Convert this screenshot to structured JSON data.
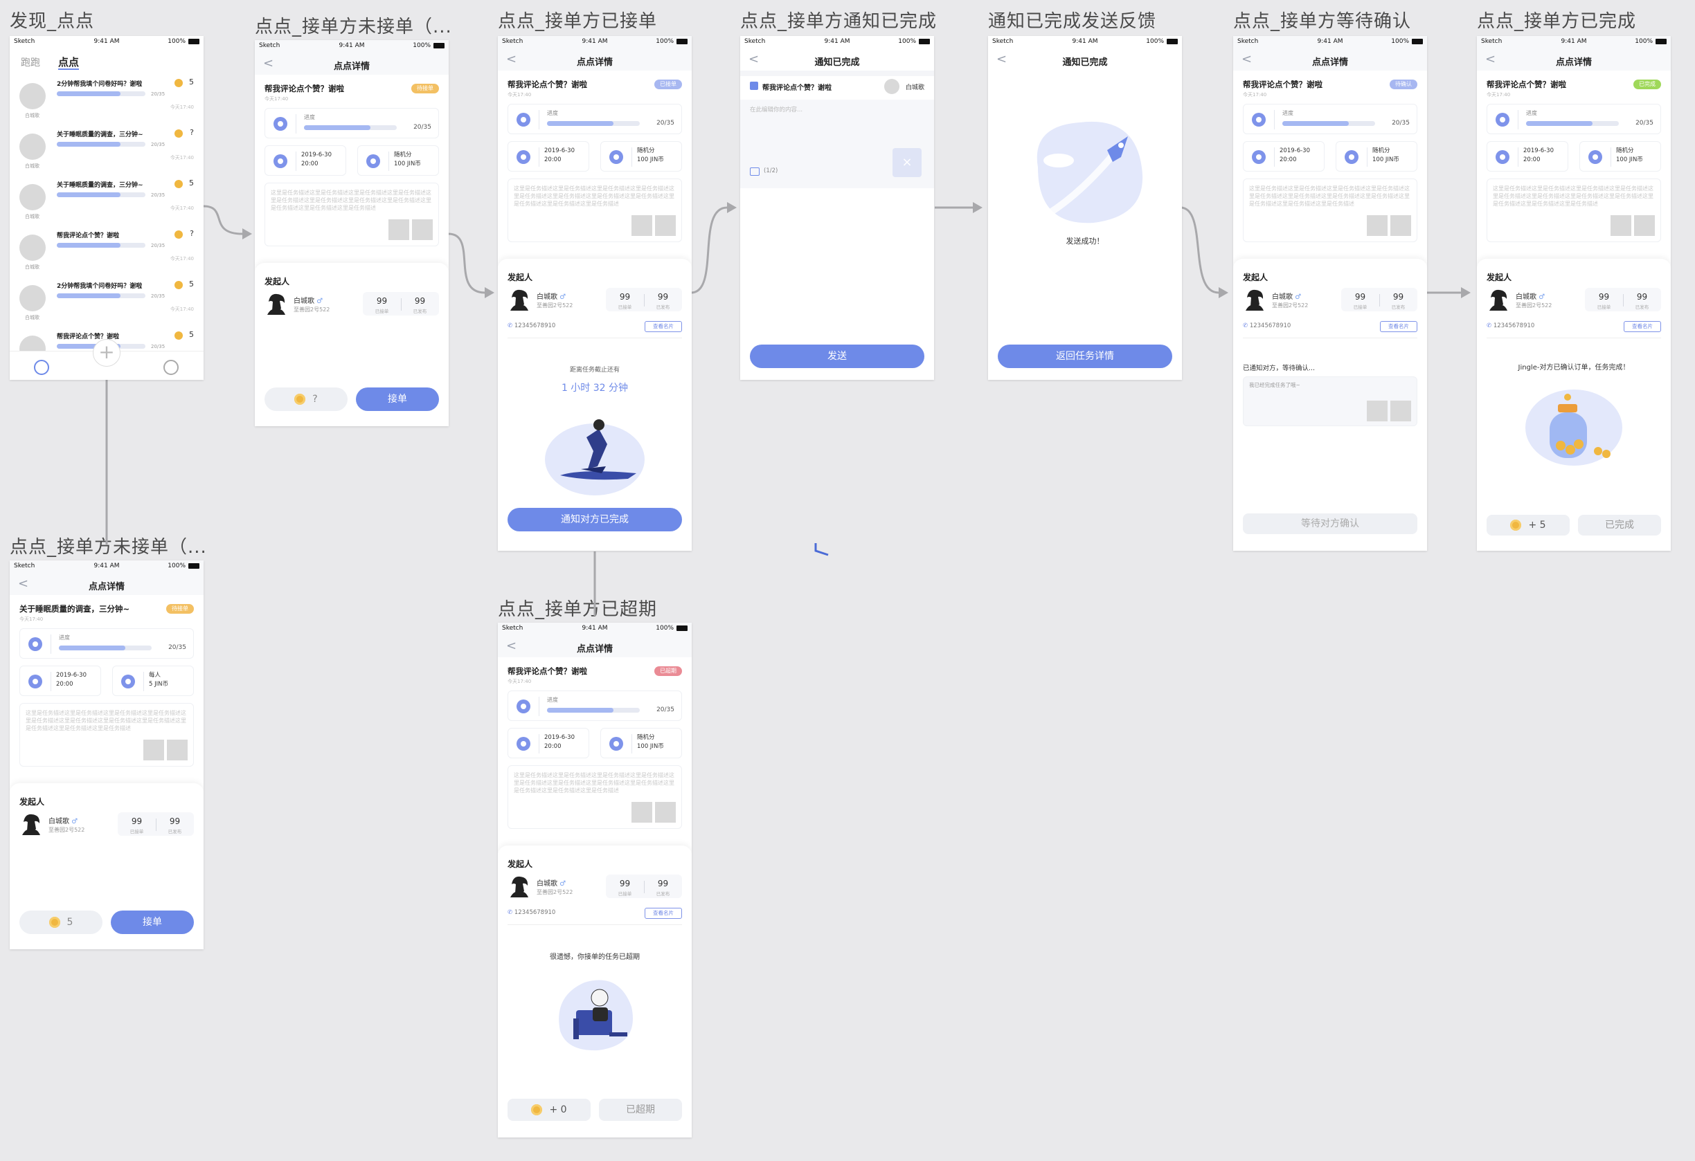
{
  "labels": {
    "discover": "发现_点点",
    "not_taken_a": "点点_接单方未接单（...",
    "not_taken_b": "点点_接单方未接单（...",
    "taken": "点点_接单方已接单",
    "notify": "点点_接单方通知已完成",
    "feedback": "通知已完成发送反馈",
    "waiting": "点点_接单方等待确认",
    "done": "点点_接单方已完成",
    "overdue": "点点_接单方已超期"
  },
  "status_bar": {
    "carrier": "Sketch",
    "time": "9:41 AM",
    "battery": "100%"
  },
  "nav": {
    "detail_title": "点点详情",
    "notify_title": "通知已完成",
    "back_glyph": "<"
  },
  "discover": {
    "tab_run": "跑跑",
    "tab_dot": "点点",
    "user_name": "白城歌",
    "items": [
      {
        "title": "2分钟帮我填个问卷好吗？谢啦",
        "count": "20/35",
        "time": "今天17:40",
        "reward": "5"
      },
      {
        "title": "关于睡眠质量的调查，三分钟~",
        "count": "20/35",
        "time": "今天17:40",
        "reward": "?"
      },
      {
        "title": "关于睡眠质量的调查，三分钟~",
        "count": "20/35",
        "time": "今天17:40",
        "reward": "5"
      },
      {
        "title": "帮我评论点个赞？谢啦",
        "count": "20/35",
        "time": "今天17:40",
        "reward": "?"
      },
      {
        "title": "2分钟帮我填个问卷好吗？谢啦",
        "count": "20/35",
        "time": "今天17:40",
        "reward": "5"
      },
      {
        "title": "帮我评论点个赞？谢啦",
        "count": "20/35",
        "time": "今天17:40",
        "reward": "5"
      }
    ]
  },
  "task": {
    "title": "帮我评论点个赞？谢啦",
    "title_sleep": "关于睡眠质量的调查，三分钟~",
    "posted": "今天17:40",
    "progress_label": "进度",
    "progress_value": "20/35",
    "progress_fraction": 0.72,
    "deadline_date": "2019-6-30",
    "deadline_time": "20:00",
    "reward_random": "随机分",
    "reward_random_amount": "100 JIN币",
    "reward_each": "每人",
    "reward_each_amount": "5 JIN币",
    "description": "这里是任务描述这里是任务描述这里是任务描述这里是任务描述这里是任务描述这里是任务描述这里是任务描述这里是任务描述这里是任务描述这里是任务描述这里是任务描述"
  },
  "badges": {
    "pending": "待接单",
    "taken": "已接单",
    "waiting": "待确认",
    "done": "已完成",
    "overdue": "已超期"
  },
  "initiator": {
    "section": "发起人",
    "name": "白城歌",
    "gender": "♂",
    "address": "至善园2号522",
    "taken_count": "99",
    "taken_label": "已接单",
    "posted_count": "99",
    "posted_label": "已发布",
    "phone": "12345678910",
    "card_button": "查看名片"
  },
  "buttons": {
    "accept": "接单",
    "coin_unknown": "?",
    "coin_five": "5",
    "notify_done": "通知对方已完成",
    "send": "发送",
    "back_to_task": "返回任务详情",
    "waiting_confirm": "等待对方确认",
    "plus_five": "+ 5",
    "done": "已完成",
    "plus_zero": "+ 0",
    "overdue": "已超期"
  },
  "taken_screen": {
    "countdown_label": "距离任务截止还有",
    "countdown_value": "1 小时 32 分钟"
  },
  "notify_screen": {
    "partner": "白城歌",
    "placeholder": "在此编辑你的内容...",
    "image_count": "(1/2)"
  },
  "feedback_screen": {
    "success": "发送成功！"
  },
  "waiting_screen": {
    "notified": "已通知对方，等待确认...",
    "message": "我已经完成任务了哦~"
  },
  "done_screen": {
    "message": "Jingle-对方已确认订单，任务完成！"
  },
  "overdue_screen": {
    "message": "很遗憾，你接单的任务已超期"
  },
  "colors": {
    "primary": "#6e8ae8",
    "pending": "#f3c063",
    "overdue": "#ea8b95",
    "done": "#9fd85a",
    "coin": "#f0b740"
  },
  "icons": [
    "back-icon",
    "progress-icon",
    "deadline-icon",
    "reward-icon",
    "phone-icon",
    "image-icon",
    "close-icon",
    "coin-icon",
    "tab-list-icon",
    "tab-add-icon",
    "tab-profile-icon",
    "rocket-illustration",
    "runner-illustration",
    "jar-illustration",
    "sleeper-illustration"
  ]
}
